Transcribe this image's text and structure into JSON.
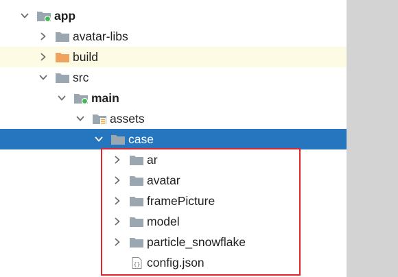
{
  "tree": {
    "rows": [
      {
        "label": "app",
        "bold": true,
        "expanded": true,
        "has_arrow": true,
        "icon": "module-folder-icon"
      },
      {
        "label": "avatar-libs",
        "bold": false,
        "expanded": false,
        "has_arrow": true,
        "icon": "folder-icon"
      },
      {
        "label": "build",
        "bold": false,
        "expanded": false,
        "has_arrow": true,
        "icon": "build-folder-icon",
        "highlight": true
      },
      {
        "label": "src",
        "bold": false,
        "expanded": true,
        "has_arrow": true,
        "icon": "folder-icon"
      },
      {
        "label": "main",
        "bold": true,
        "expanded": true,
        "has_arrow": true,
        "icon": "module-folder-icon"
      },
      {
        "label": "assets",
        "bold": false,
        "expanded": true,
        "has_arrow": true,
        "icon": "assets-folder-icon"
      },
      {
        "label": "case",
        "bold": false,
        "expanded": true,
        "has_arrow": true,
        "icon": "folder-icon",
        "selected": true
      },
      {
        "label": "ar",
        "bold": false,
        "expanded": false,
        "has_arrow": true,
        "icon": "folder-icon"
      },
      {
        "label": "avatar",
        "bold": false,
        "expanded": false,
        "has_arrow": true,
        "icon": "folder-icon"
      },
      {
        "label": "framePicture",
        "bold": false,
        "expanded": false,
        "has_arrow": true,
        "icon": "folder-icon"
      },
      {
        "label": "model",
        "bold": false,
        "expanded": false,
        "has_arrow": true,
        "icon": "folder-icon"
      },
      {
        "label": "particle_snowflake",
        "bold": false,
        "expanded": false,
        "has_arrow": true,
        "icon": "folder-icon"
      },
      {
        "label": "config.json",
        "bold": false,
        "expanded": false,
        "has_arrow": false,
        "icon": "json-file-icon"
      }
    ]
  },
  "colors": {
    "selection": "#2675bf",
    "highlight": "#fefbe4",
    "folder": "#9aa7b0",
    "build_folder": "#f0a35e",
    "module_dot": "#3fb950",
    "annotation_border": "#e0242c",
    "scrollbar": "#d3d3d3"
  }
}
